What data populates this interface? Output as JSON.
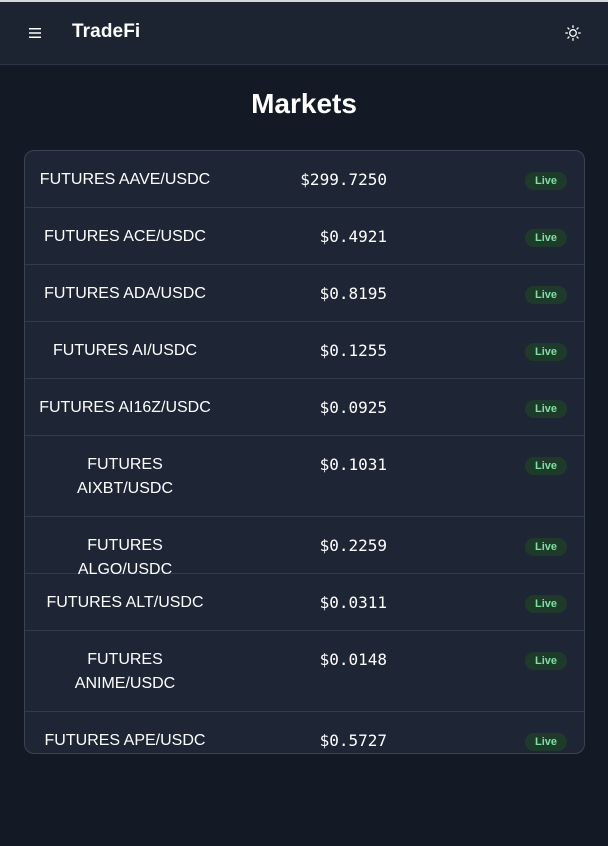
{
  "app": {
    "title": "TradeFi"
  },
  "header": {
    "menu_icon": "hamburger-icon",
    "theme_icon": "sun-icon"
  },
  "page": {
    "title": "Markets"
  },
  "colors": {
    "background": "#131a26",
    "navbar": "#1c2431",
    "card": "#1e2636",
    "live_badge_bg": "#1e3a2b",
    "live_badge_text": "#7fe0a0"
  },
  "markets": [
    {
      "name": "FUTURES AAVE/USDC",
      "price": "$299.7250",
      "status": "Live"
    },
    {
      "name": "FUTURES ACE/USDC",
      "price": "$0.4921",
      "status": "Live"
    },
    {
      "name": "FUTURES ADA/USDC",
      "price": "$0.8195",
      "status": "Live"
    },
    {
      "name": "FUTURES AI/USDC",
      "price": "$0.1255",
      "status": "Live"
    },
    {
      "name": "FUTURES AI16Z/USDC",
      "price": "$0.0925",
      "status": "Live"
    },
    {
      "name": "FUTURES AIXBT/USDC",
      "price": "$0.1031",
      "status": "Live"
    },
    {
      "name": "FUTURES ALGO/USDC",
      "price": "$0.2259",
      "status": "Live"
    },
    {
      "name": "FUTURES ALT/USDC",
      "price": "$0.0311",
      "status": "Live"
    },
    {
      "name": "FUTURES ANIME/USDC",
      "price": "$0.0148",
      "status": "Live"
    },
    {
      "name": "FUTURES APE/USDC",
      "price": "$0.5727",
      "status": "Live"
    }
  ]
}
